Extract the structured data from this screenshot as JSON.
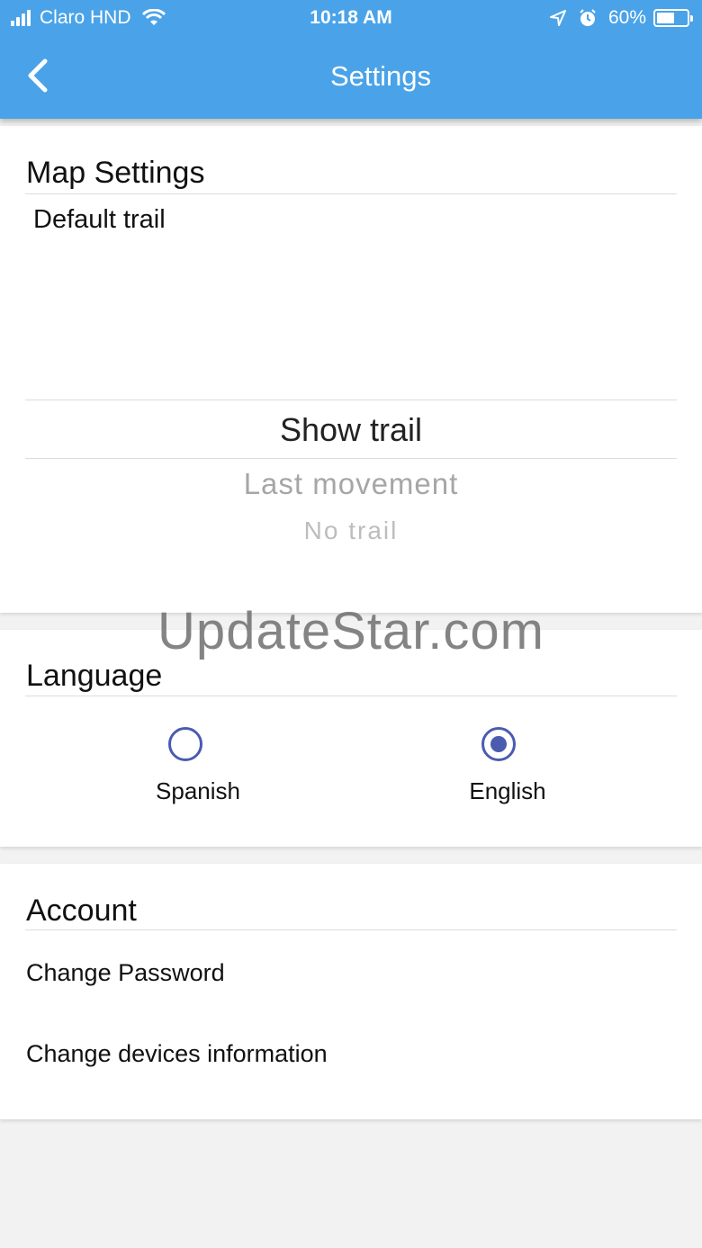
{
  "status_bar": {
    "carrier": "Claro HND",
    "time": "10:18 AM",
    "battery": "60%",
    "battery_level": 0.6
  },
  "nav": {
    "title": "Settings",
    "back_icon": "chevron-left-icon"
  },
  "map_settings": {
    "title": "Map Settings",
    "default_trail_label": "Default trail",
    "options": [
      {
        "label": "Show trail",
        "selected": true
      },
      {
        "label": "Last movement",
        "selected": false
      },
      {
        "label": "No trail",
        "selected": false
      }
    ]
  },
  "language": {
    "title": "Language",
    "options": [
      {
        "label": "Spanish",
        "selected": false
      },
      {
        "label": "English",
        "selected": true
      }
    ]
  },
  "account": {
    "title": "Account",
    "items": [
      {
        "label": "Change Password"
      },
      {
        "label": "Change devices information"
      }
    ]
  },
  "watermark": "UpdateStar.com",
  "colors": {
    "app_bar": "#4aa3e8",
    "radio_accent": "#4a5bb0"
  }
}
